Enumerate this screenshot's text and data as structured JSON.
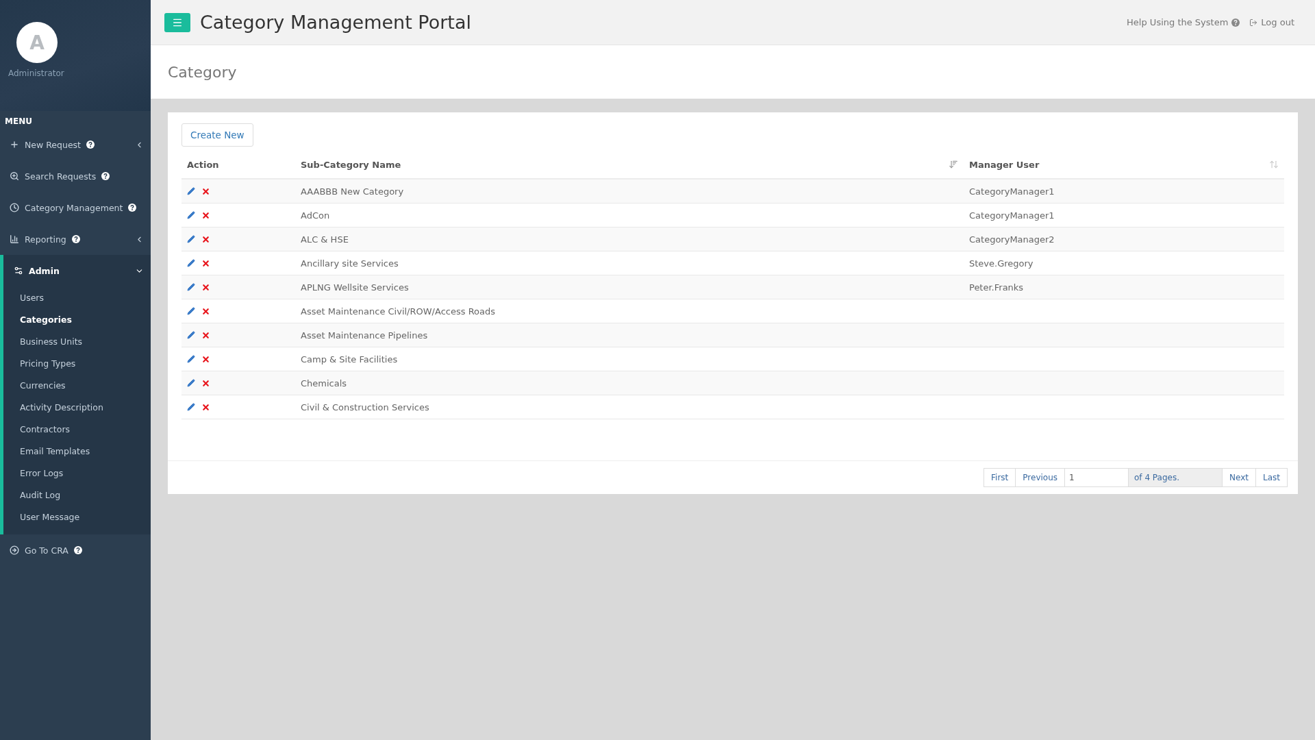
{
  "profile": {
    "initial": "A",
    "role": "Administrator"
  },
  "sidebar": {
    "heading": "MENU",
    "items": [
      {
        "label": "New Request",
        "kind": "plus",
        "help": true,
        "submenu": true,
        "expanded": false
      },
      {
        "label": "Search Requests",
        "kind": "search",
        "help": true,
        "submenu": false,
        "expanded": false
      },
      {
        "label": "Category Management",
        "kind": "clock",
        "help": true,
        "submenu": false,
        "expanded": false
      },
      {
        "label": "Reporting",
        "kind": "chart",
        "help": true,
        "submenu": true,
        "expanded": false
      },
      {
        "label": "Admin",
        "kind": "cogs",
        "help": false,
        "submenu": true,
        "expanded": true,
        "children": [
          {
            "label": "Users",
            "selected": false
          },
          {
            "label": "Categories",
            "selected": true
          },
          {
            "label": "Business Units",
            "selected": false
          },
          {
            "label": "Pricing Types",
            "selected": false
          },
          {
            "label": "Currencies",
            "selected": false
          },
          {
            "label": "Activity Description",
            "selected": false
          },
          {
            "label": "Contractors",
            "selected": false
          },
          {
            "label": "Email Templates",
            "selected": false
          },
          {
            "label": "Error Logs",
            "selected": false
          },
          {
            "label": "Audit Log",
            "selected": false
          },
          {
            "label": "User Message",
            "selected": false
          }
        ]
      },
      {
        "label": "Go To CRA",
        "kind": "arrow",
        "help": true,
        "submenu": false,
        "expanded": false
      }
    ]
  },
  "header": {
    "title": "Category Management Portal",
    "help_link": "Help Using the System",
    "logout": "Log out"
  },
  "page": {
    "title": "Category"
  },
  "toolbar": {
    "create_button": "Create New"
  },
  "table": {
    "columns": [
      {
        "label": "Action",
        "sortable": false,
        "sorted": false
      },
      {
        "label": "Sub-Category Name",
        "sortable": true,
        "sorted": true
      },
      {
        "label": "Manager User",
        "sortable": true,
        "sorted": false
      }
    ],
    "rows": [
      {
        "name": "AAABBB New Category",
        "manager": "CategoryManager1"
      },
      {
        "name": "AdCon",
        "manager": "CategoryManager1"
      },
      {
        "name": "ALC & HSE",
        "manager": "CategoryManager2"
      },
      {
        "name": "Ancillary site Services",
        "manager": "Steve.Gregory"
      },
      {
        "name": "APLNG Wellsite Services",
        "manager": "Peter.Franks"
      },
      {
        "name": "Asset Maintenance Civil/ROW/Access Roads"
      },
      {
        "name": "Asset Maintenance Pipelines"
      },
      {
        "name": "Camp & Site Facilities"
      },
      {
        "name": "Chemicals"
      },
      {
        "name": "Civil & Construction Services"
      }
    ]
  },
  "pagination": {
    "first": "First",
    "previous": "Previous",
    "page_value": "1",
    "page_count": "of 4 Pages.",
    "next": "Next",
    "last": "Last"
  }
}
